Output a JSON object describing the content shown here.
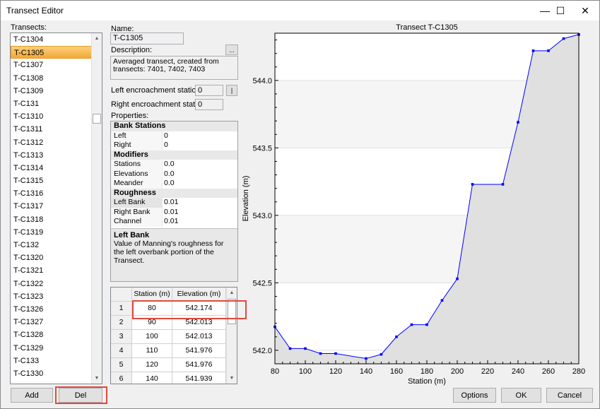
{
  "window": {
    "title": "Transect Editor",
    "minimize_glyph": "—",
    "maximize_glyph": "☐",
    "close_glyph": "✕"
  },
  "transects": {
    "label": "Transects:",
    "items": [
      "T-C1304",
      "T-C1305",
      "T-C1307",
      "T-C1308",
      "T-C1309",
      "T-C131",
      "T-C1310",
      "T-C1311",
      "T-C1312",
      "T-C1313",
      "T-C1314",
      "T-C1315",
      "T-C1316",
      "T-C1317",
      "T-C1318",
      "T-C1319",
      "T-C132",
      "T-C1320",
      "T-C1321",
      "T-C1322",
      "T-C1323",
      "T-C1326",
      "T-C1327",
      "T-C1328",
      "T-C1329",
      "T-C133",
      "T-C1330"
    ],
    "selected": "T-C1305"
  },
  "buttons": {
    "add": "Add",
    "del": "Del",
    "options": "Options",
    "ok": "OK",
    "cancel": "Cancel",
    "ellipsis": "...",
    "pipe": "|"
  },
  "form": {
    "name_label": "Name:",
    "name_value": "T-C1305",
    "description_label": "Description:",
    "description_value": "Averaged transect, created from transects: 7401, 7402, 7403",
    "left_enc_label": "Left encroachment station:",
    "left_enc_value": "0",
    "right_enc_label": "Right encroachment station:",
    "right_enc_value": "0",
    "properties_label": "Properties:"
  },
  "properties": {
    "bank_stations": "Bank Stations",
    "left_name": "Left",
    "left_value": "0",
    "right_name": "Right",
    "right_value": "0",
    "modifiers": "Modifiers",
    "stations_name": "Stations",
    "stations_value": "0.0",
    "elevations_name": "Elevations",
    "elevations_value": "0.0",
    "meander_name": "Meander",
    "meander_value": "0.0",
    "roughness": "Roughness",
    "left_bank_name": "Left Bank",
    "left_bank_value": "0.01",
    "right_bank_name": "Right Bank",
    "right_bank_value": "0.01",
    "channel_name": "Channel",
    "channel_value": "0.01",
    "help_title": "Left Bank",
    "help_text": "Value of Manning's roughness for the left overbank portion of the Transect."
  },
  "grid": {
    "col_station": "Station (m)",
    "col_elevation": "Elevation (m)",
    "rows": [
      {
        "n": "1",
        "station": "80",
        "elevation": "542.174"
      },
      {
        "n": "2",
        "station": "90",
        "elevation": "542.013"
      },
      {
        "n": "3",
        "station": "100",
        "elevation": "542.013"
      },
      {
        "n": "4",
        "station": "110",
        "elevation": "541.976"
      },
      {
        "n": "5",
        "station": "120",
        "elevation": "541.976"
      },
      {
        "n": "6",
        "station": "140",
        "elevation": "541.939"
      }
    ]
  },
  "chart_data": {
    "type": "area",
    "title": "Transect T-C1305",
    "xlabel": "Station (m)",
    "ylabel": "Elevation (m)",
    "xlim": [
      80,
      280
    ],
    "ylim": [
      541.9,
      544.35
    ],
    "x_ticks": [
      80,
      100,
      120,
      140,
      160,
      180,
      200,
      220,
      240,
      260,
      280
    ],
    "y_ticks": [
      "542.0",
      "542.5",
      "543.0",
      "543.5",
      "544.0"
    ],
    "grid": true,
    "line_color": "#0000ff",
    "fill_color": "#e0e0e0",
    "series": [
      {
        "x": [
          80,
          90,
          100,
          110,
          120,
          140,
          150,
          160,
          170,
          180,
          190,
          200,
          210,
          230,
          240,
          250,
          260,
          270,
          280
        ],
        "y": [
          542.174,
          542.013,
          542.013,
          541.976,
          541.976,
          541.939,
          541.97,
          542.1,
          542.19,
          542.19,
          542.37,
          542.53,
          543.23,
          543.23,
          543.69,
          544.22,
          544.22,
          544.31,
          544.34
        ]
      }
    ]
  }
}
